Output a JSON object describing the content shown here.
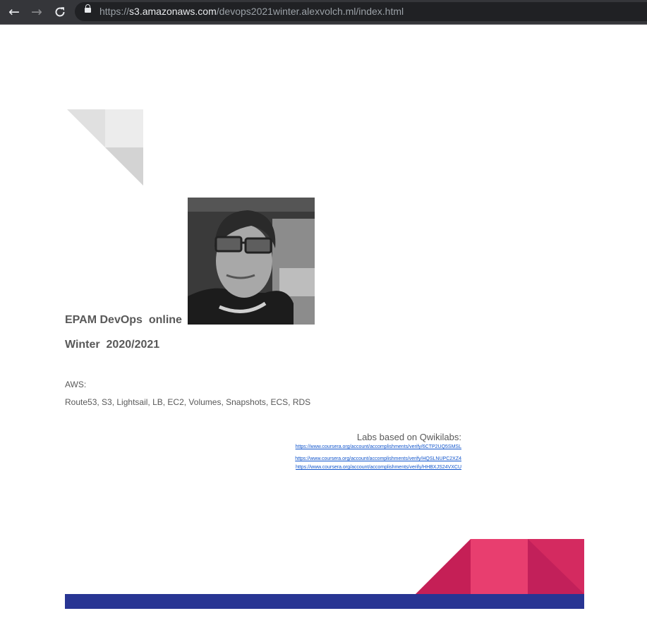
{
  "browser": {
    "back_icon": "arrow-left-icon",
    "forward_icon": "arrow-right-icon",
    "reload_icon": "reload-icon",
    "lock_icon": "lock-icon",
    "url_scheme": "https://",
    "url_host": "s3.amazonaws.com",
    "url_path": "/devops2021winter.alexvolch.ml/index.html"
  },
  "page": {
    "title_line1": "EPAM DevOps  online",
    "title_line2": "Winter  2020/2021",
    "aws_label": "AWS:",
    "aws_services": "Route53, S3, Lightsail, LB, EC2, Volumes, Snapshots, ECS, RDS",
    "labs_title": "Labs based on Qwikilabs:",
    "lab_links": [
      "https://www.coursera.org/account/accomplishments/verify/6CTP2UQ5SMSL",
      "https://www.coursera.org/account/accomplishments/verify/HQSLNUPC2XZ4",
      "https://www.coursera.org/account/accomplishments/verify/HHBXJS24VXCU"
    ]
  },
  "colors": {
    "text_gray": "#595959",
    "link_blue": "#1155cc",
    "footer_navy": "#283593",
    "accent_pink": "#e83e6f",
    "accent_crimson": "#c51f56"
  }
}
